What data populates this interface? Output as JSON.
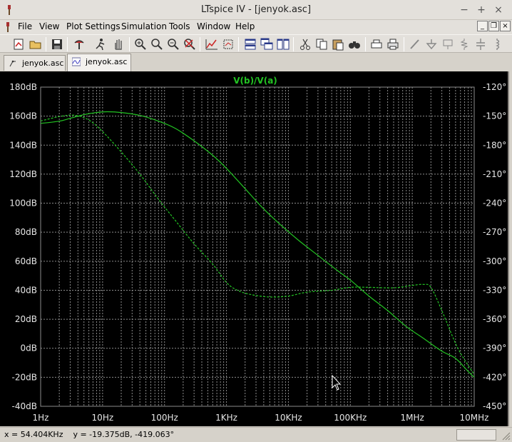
{
  "window": {
    "title": "LTspice IV - [jenyok.asc]"
  },
  "menu": {
    "items": [
      {
        "label": "File",
        "accel": "F"
      },
      {
        "label": "View",
        "accel": "V"
      },
      {
        "label": "Plot Settings",
        "accel": "P"
      },
      {
        "label": "Simulation",
        "accel": "S"
      },
      {
        "label": "Tools",
        "accel": "T"
      },
      {
        "label": "Window",
        "accel": "W"
      },
      {
        "label": "Help",
        "accel": "H"
      }
    ]
  },
  "tabs": [
    {
      "label": "jenyok.asc",
      "active": false,
      "icon": "schematic-icon"
    },
    {
      "label": "jenyok.asc",
      "active": true,
      "icon": "waveform-icon"
    }
  ],
  "toolbar": {
    "buttons": [
      "new-schematic-icon",
      "open-icon",
      "save-icon",
      "control-panel-icon",
      "run-icon",
      "pan-icon",
      "zoom-in-icon",
      "zoom-area-icon",
      "zoom-out-icon",
      "zoom-fit-icon",
      "autorange-icon",
      "mark-unsortable-icon",
      "tile-horizontal-icon",
      "cascade-icon",
      "tile-vertical-icon",
      "cut-icon",
      "copy-icon",
      "paste-icon",
      "find-icon",
      "print-setup-icon",
      "print-icon",
      "wire-icon",
      "ground-icon",
      "label-net-icon",
      "resistor-icon",
      "capacitor-icon",
      "inductor-icon"
    ]
  },
  "plot": {
    "trace_label": "V(b)/V(a)",
    "colors": {
      "background": "#000000",
      "grid": "#8c8c8c",
      "trace": "#23c323",
      "axis_text": "#e6e6e6"
    },
    "grid": true
  },
  "chart_data": {
    "type": "line",
    "title": "V(b)/V(a)",
    "x_scale": "log",
    "xlim": [
      1,
      10000000
    ],
    "x_ticks": [
      "1Hz",
      "10Hz",
      "100Hz",
      "1KHz",
      "10KHz",
      "100KHz",
      "1MHz",
      "10MHz"
    ],
    "ylim_left": [
      -40,
      180
    ],
    "y_ticks_left": [
      "180dB",
      "160dB",
      "140dB",
      "120dB",
      "100dB",
      "80dB",
      "60dB",
      "40dB",
      "20dB",
      "0dB",
      "-20dB",
      "-40dB"
    ],
    "ylim_right": [
      -450,
      -120
    ],
    "y_ticks_right": [
      "-120°",
      "-150°",
      "-180°",
      "-210°",
      "-240°",
      "-270°",
      "-300°",
      "-330°",
      "-360°",
      "-390°",
      "-420°",
      "-450°"
    ],
    "series": [
      {
        "style": "solid",
        "axis": "left",
        "x": [
          1,
          2,
          3,
          5,
          8,
          12,
          20,
          40,
          80,
          150,
          300,
          600,
          1000,
          2000,
          4000,
          8000,
          15000,
          30000,
          60000,
          100000,
          200000,
          400000,
          800000,
          1500000,
          3000000,
          5000000,
          8000000,
          10000000
        ],
        "values": [
          155,
          156.5,
          158.5,
          161,
          162.5,
          163,
          162.5,
          160.5,
          156.5,
          151.5,
          143,
          133,
          124,
          110,
          96,
          84,
          74,
          64,
          54,
          47,
          36,
          26,
          15,
          7,
          -2,
          -7,
          -16,
          -20
        ]
      },
      {
        "style": "dashed",
        "axis": "right",
        "x": [
          1,
          2,
          3.5,
          6,
          10,
          20,
          40,
          80,
          150,
          300,
          600,
          1000,
          1500,
          2500,
          5000,
          10000,
          20000,
          50000,
          100000,
          200000,
          500000,
          1000000,
          1500000,
          2000000,
          3000000,
          5000000,
          7000000,
          10000000
        ],
        "values": [
          -155,
          -150.5,
          -149,
          -154,
          -166,
          -187,
          -210,
          -236,
          -258,
          -282,
          -303,
          -322,
          -330,
          -334.5,
          -337,
          -336,
          -332,
          -330,
          -327,
          -327,
          -327.5,
          -325,
          -324,
          -327,
          -351,
          -385,
          -402,
          -417
        ]
      }
    ],
    "cursor": {
      "x": "54.404KHz",
      "y_mag": "-19.375dB",
      "y_phase": "-419.063°"
    }
  },
  "status": {
    "readout": "x = 54.404KHz    y = -19.375dB, -419.063°"
  }
}
